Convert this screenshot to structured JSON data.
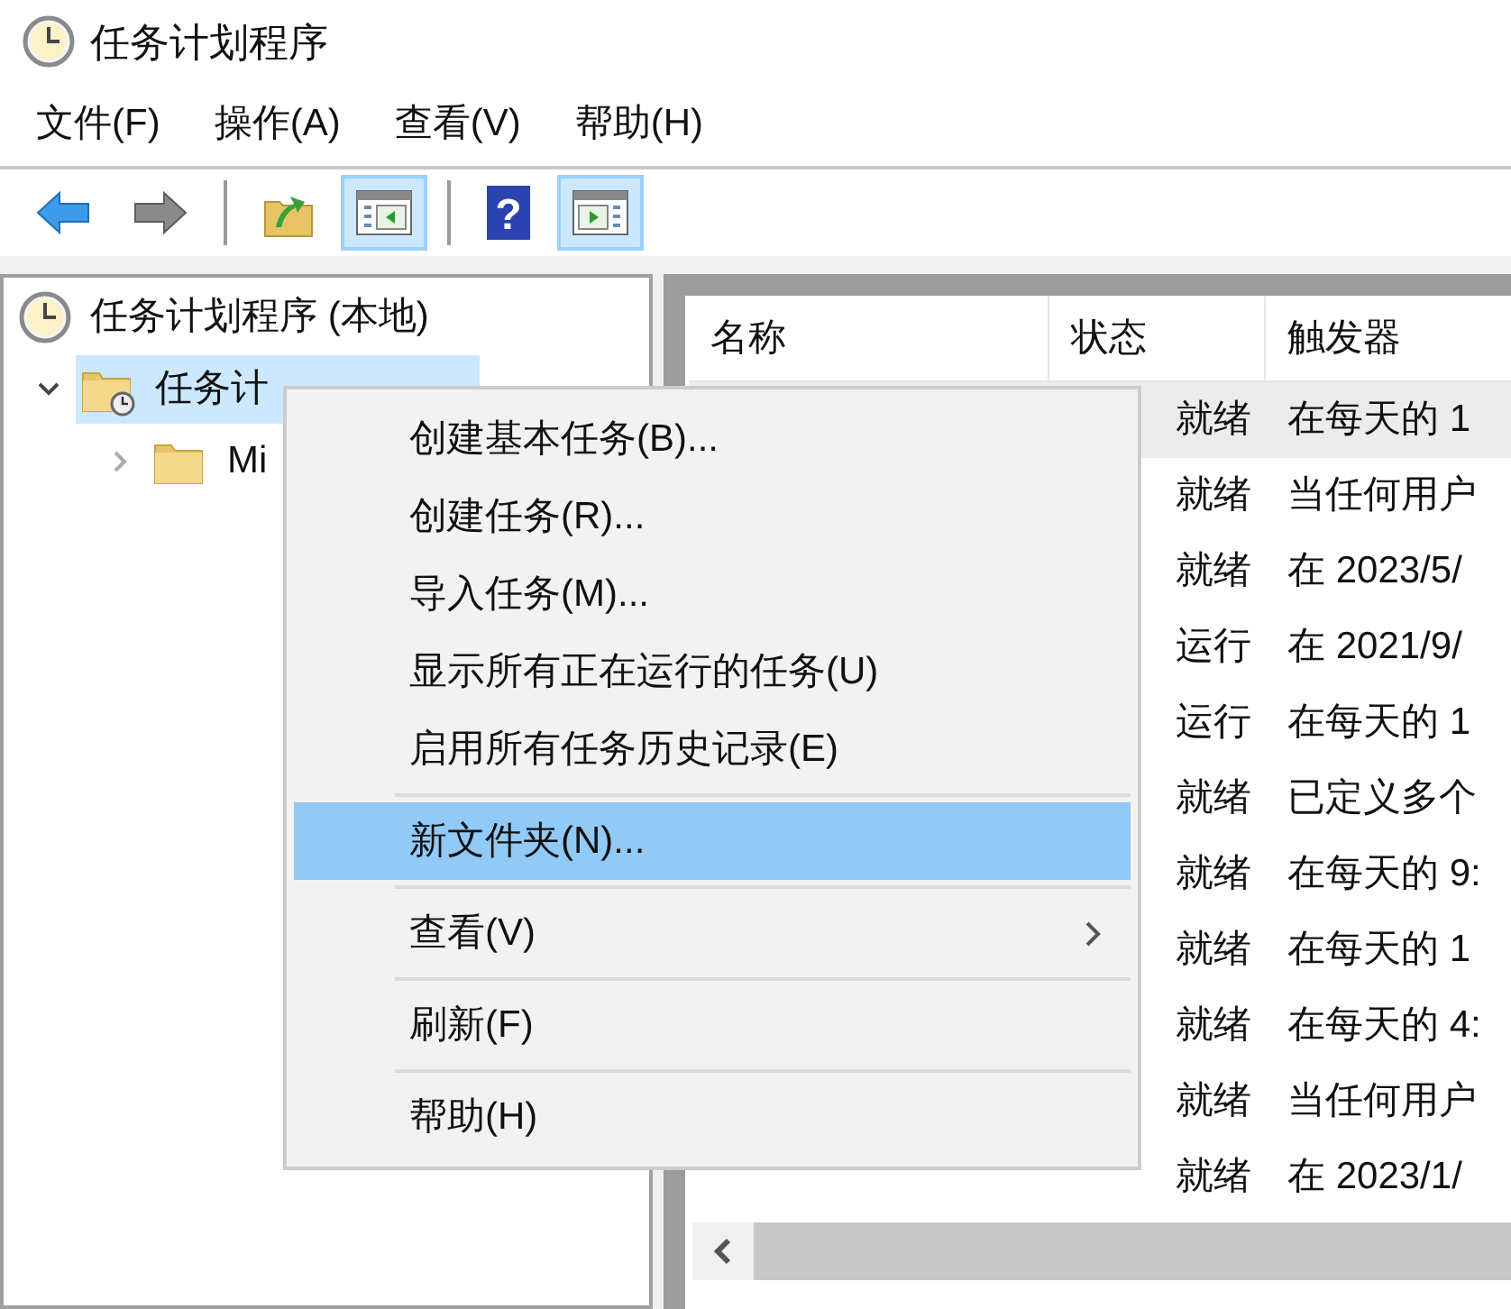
{
  "window": {
    "title": "任务计划程序"
  },
  "menu_bar": [
    "文件(F)",
    "操作(A)",
    "查看(V)",
    "帮助(H)"
  ],
  "toolbar": [
    {
      "kind": "back"
    },
    {
      "kind": "forward"
    },
    {
      "kind": "separator"
    },
    {
      "kind": "up"
    },
    {
      "kind": "console_tree",
      "selected": true
    },
    {
      "kind": "separator"
    },
    {
      "kind": "help",
      "glyph": "?"
    },
    {
      "kind": "action_pane",
      "selected": true
    }
  ],
  "tree": [
    {
      "label": "任务计划程序 (本地)",
      "kind": "root",
      "selected": false,
      "children": [
        {
          "label": "任务计",
          "kind": "library",
          "selected": true,
          "expanded": true,
          "children": [
            {
              "label": "Mi",
              "kind": "folder",
              "selected": false,
              "expanded": false
            }
          ]
        }
      ]
    }
  ],
  "table": {
    "columns": [
      "名称",
      "状态",
      "触发器"
    ],
    "rows": [
      {
        "status": "就绪",
        "trigger": "在每天的 1",
        "selected": true
      },
      {
        "status": "就绪",
        "trigger": "当任何用户",
        "selected": false
      },
      {
        "status": "就绪",
        "trigger": "在 2023/5/",
        "selected": false
      },
      {
        "status": "运行",
        "trigger": "在 2021/9/",
        "selected": false
      },
      {
        "status": "运行",
        "trigger": "在每天的 1",
        "selected": false
      },
      {
        "status": "就绪",
        "trigger": "已定义多个",
        "selected": false
      },
      {
        "status": "就绪",
        "trigger": "在每天的 9:",
        "selected": false
      },
      {
        "status": "就绪",
        "trigger": "在每天的 1",
        "selected": false
      },
      {
        "status": "就绪",
        "trigger": "在每天的 4:",
        "selected": false
      },
      {
        "status": "就绪",
        "trigger": "当任何用户",
        "selected": false
      },
      {
        "status": "就绪",
        "trigger": "在 2023/1/",
        "selected": false
      }
    ]
  },
  "context_menu": [
    {
      "kind": "item",
      "label": "创建基本任务(B)...",
      "selected": false
    },
    {
      "kind": "item",
      "label": "创建任务(R)...",
      "selected": false
    },
    {
      "kind": "item",
      "label": "导入任务(M)...",
      "selected": false
    },
    {
      "kind": "item",
      "label": "显示所有正在运行的任务(U)",
      "selected": false
    },
    {
      "kind": "item",
      "label": "启用所有任务历史记录(E)",
      "selected": false
    },
    {
      "kind": "separator"
    },
    {
      "kind": "item",
      "label": "新文件夹(N)...",
      "selected": true
    },
    {
      "kind": "separator"
    },
    {
      "kind": "submenu",
      "label": "查看(V)",
      "selected": false
    },
    {
      "kind": "separator"
    },
    {
      "kind": "item",
      "label": "刷新(F)",
      "selected": false
    },
    {
      "kind": "separator"
    },
    {
      "kind": "item",
      "label": "帮助(H)",
      "selected": false
    }
  ]
}
